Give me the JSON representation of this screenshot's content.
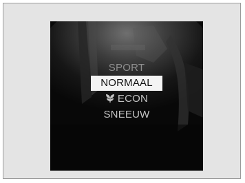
{
  "drive_mode_menu": {
    "items": [
      {
        "label": "SPORT",
        "icon": ""
      },
      {
        "label": "NORMAAL",
        "icon": ""
      },
      {
        "label": "ECON",
        "icon": "leaf-icon"
      },
      {
        "label": "SNEEUW",
        "icon": ""
      }
    ],
    "selected_index": 1,
    "selected_background": "#f4f4f4",
    "selected_text_color": "#111111",
    "text_color": "#c4c4c4"
  }
}
